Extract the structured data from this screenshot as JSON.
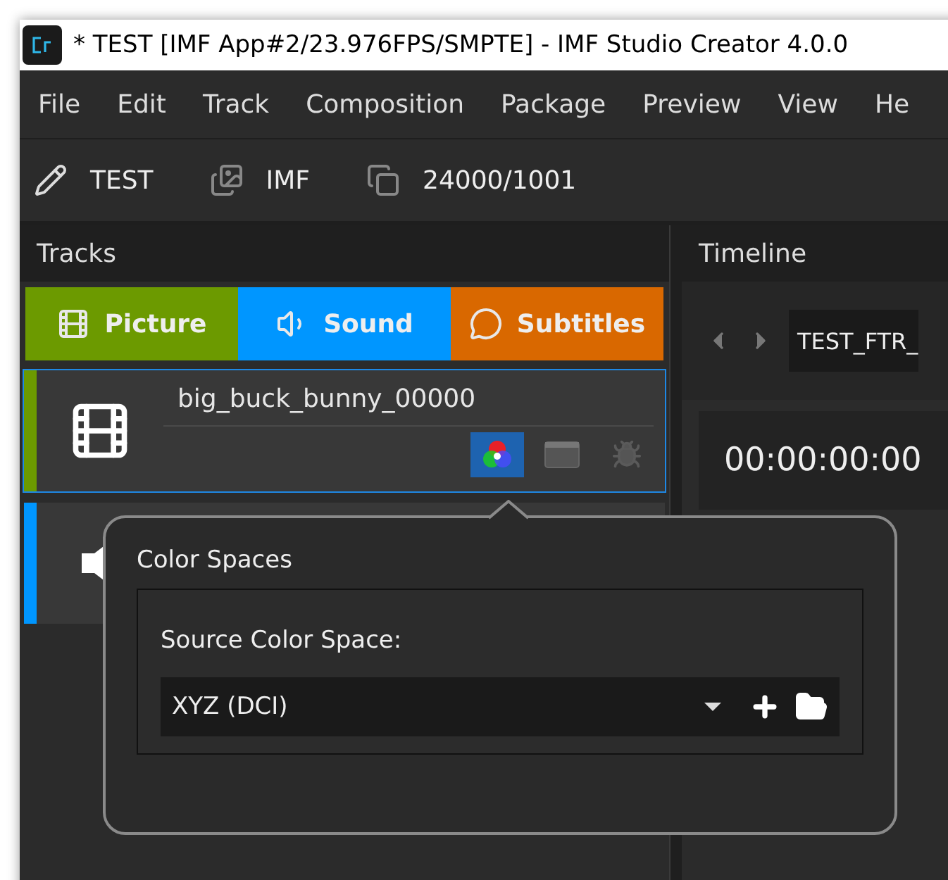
{
  "window": {
    "title": "* TEST [IMF App#2/23.976FPS/SMPTE] - IMF Studio Creator 4.0.0"
  },
  "menu": [
    "File",
    "Edit",
    "Track",
    "Composition",
    "Package",
    "Preview",
    "View",
    "He"
  ],
  "toolbar": [
    {
      "kind": "edit",
      "label": "TEST"
    },
    {
      "kind": "images",
      "label": "IMF"
    },
    {
      "kind": "copy",
      "label": "24000/1001"
    }
  ],
  "tracks_panel": {
    "title": "Tracks",
    "add_buttons": [
      {
        "kind": "picture",
        "label": "Picture",
        "color": "#6c9a00"
      },
      {
        "kind": "sound",
        "label": "Sound",
        "color": "#0096ff"
      },
      {
        "kind": "subtitles",
        "label": "Subtitles",
        "color": "#d96800"
      }
    ],
    "tracks": [
      {
        "kind": "picture",
        "name": "big_buck_bunny_00000",
        "selected": true,
        "color": "#6c9a00",
        "color_spaces_open": true
      },
      {
        "kind": "sound",
        "selected": false,
        "color": "#0096ff"
      }
    ]
  },
  "timeline_panel": {
    "title": "Timeline",
    "composition_tab": "TEST_FTR_",
    "timecode": "00:00:00:00"
  },
  "color_spaces_popup": {
    "title": "Color Spaces",
    "source_label": "Source Color Space:",
    "source_value": "XYZ (DCI)"
  }
}
